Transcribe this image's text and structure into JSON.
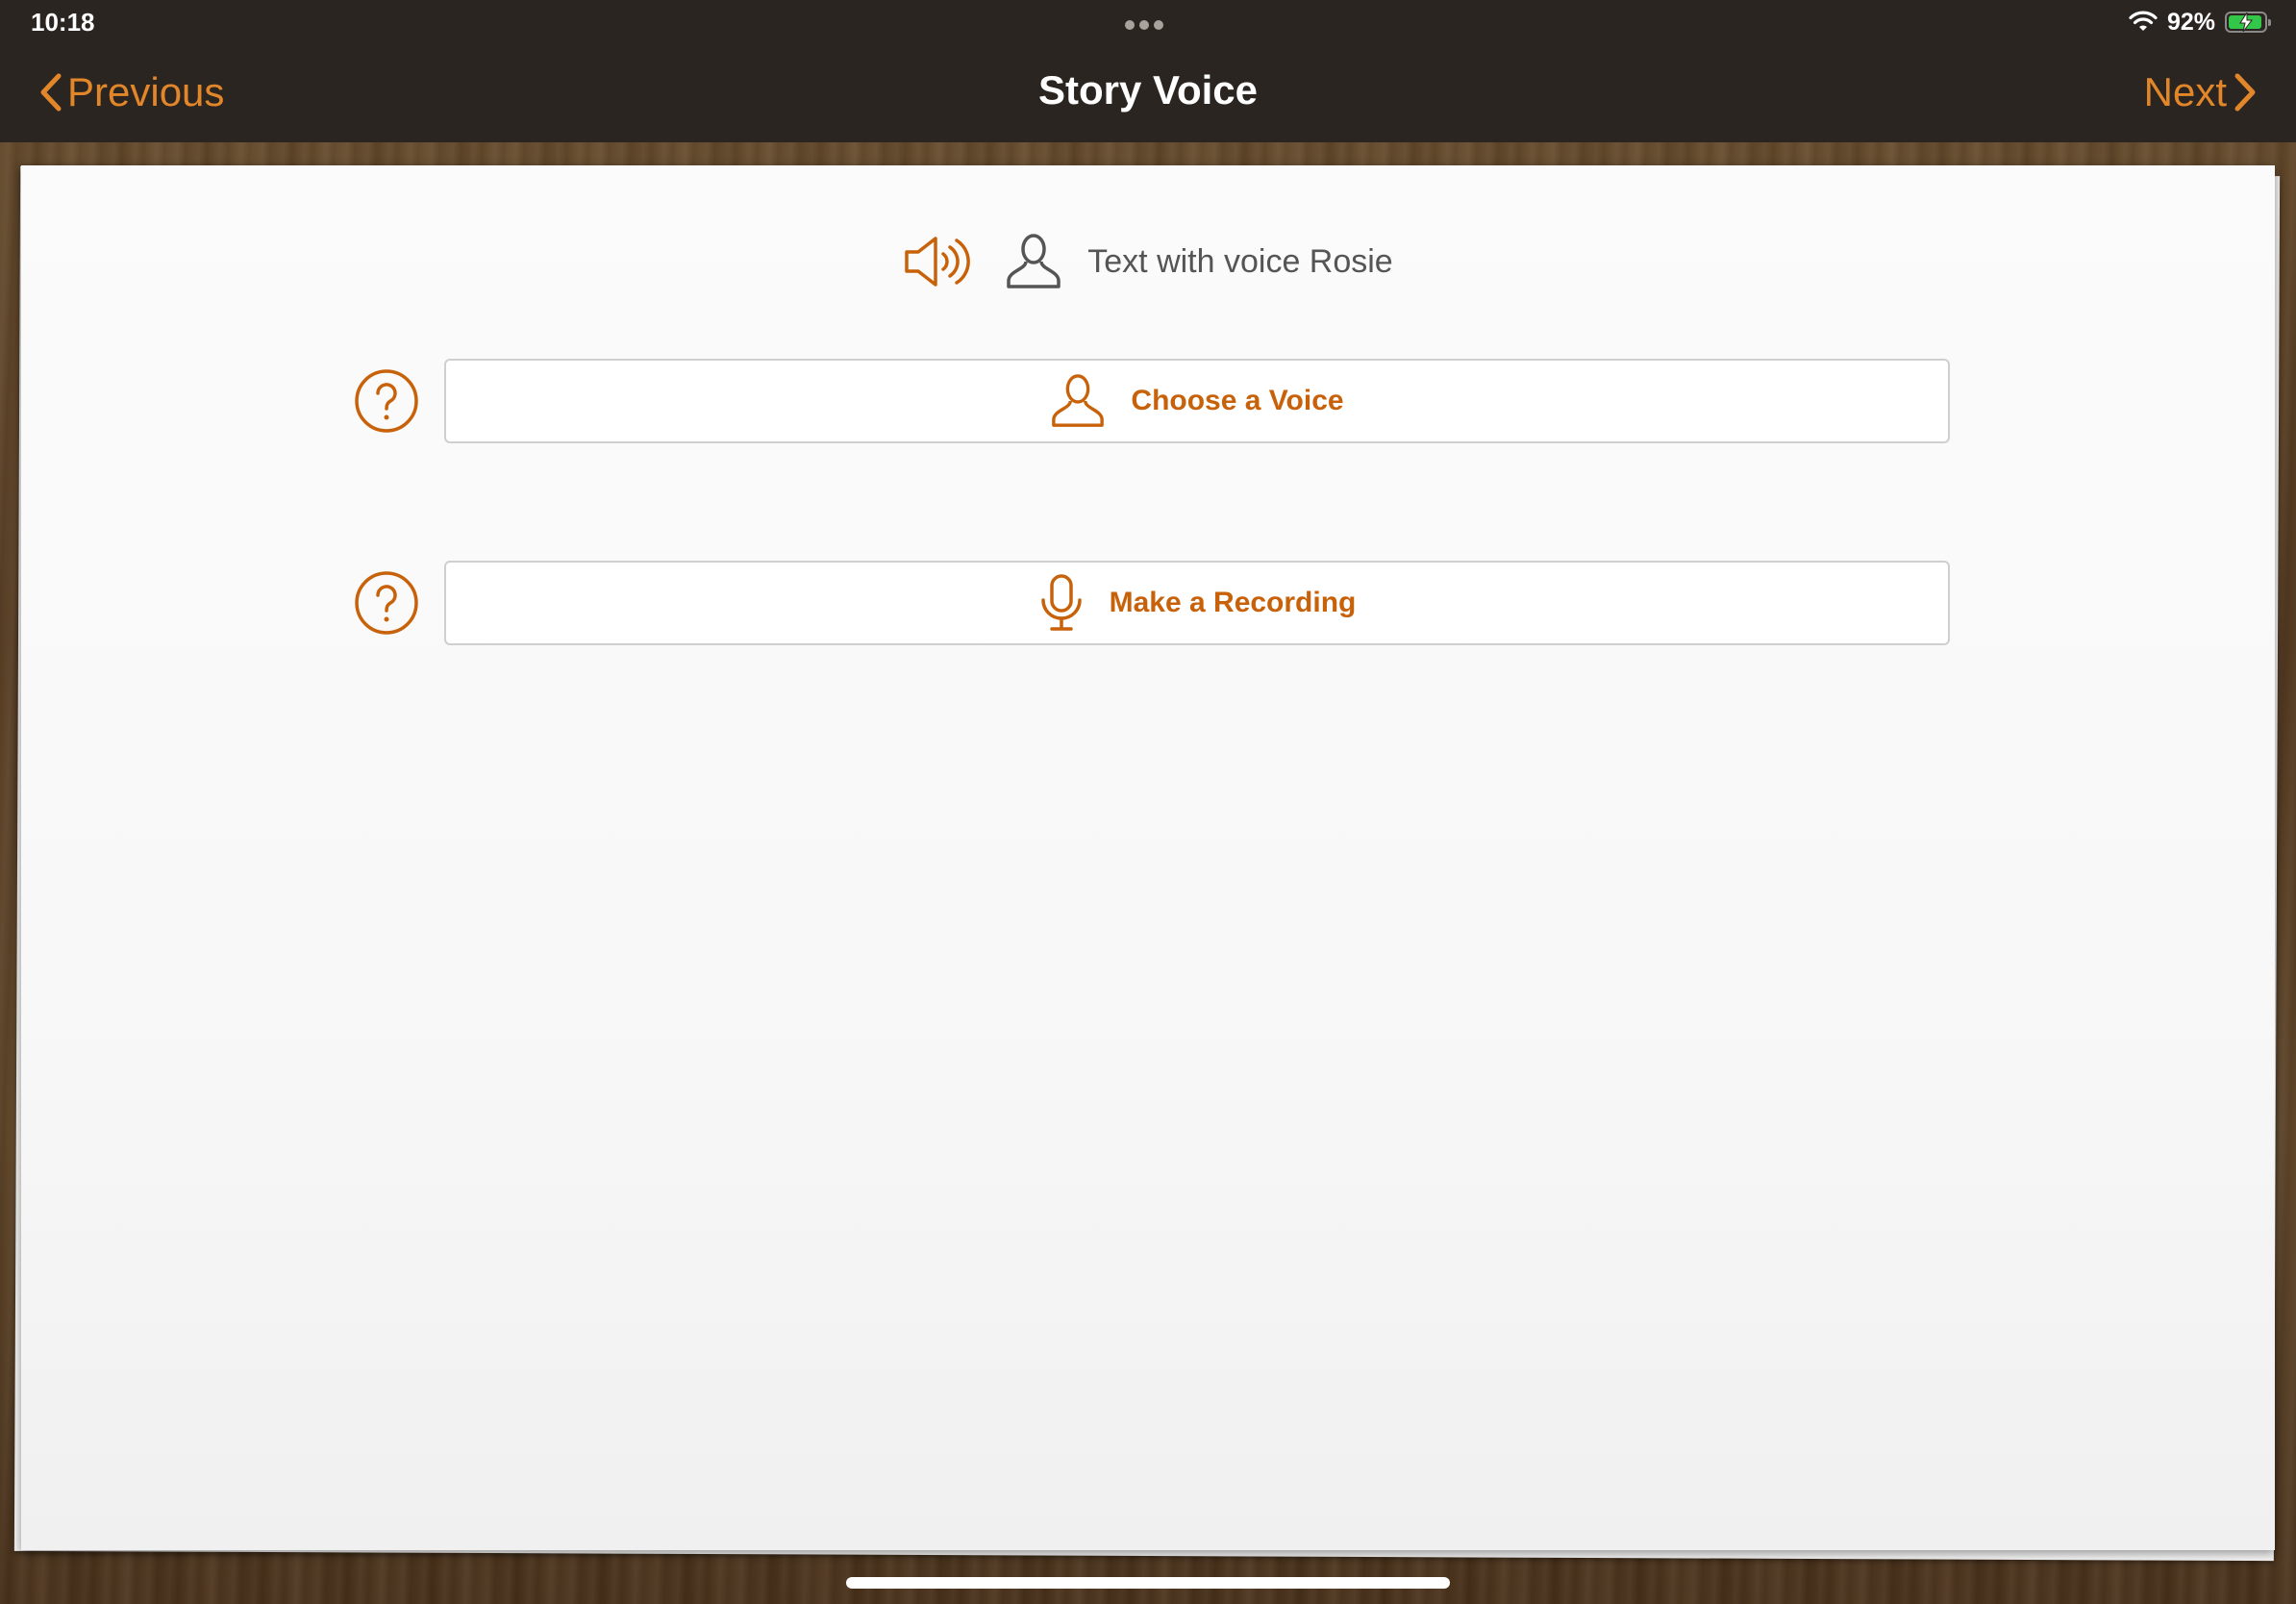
{
  "status_bar": {
    "time": "10:18",
    "battery_percent": "92%"
  },
  "nav": {
    "previous_label": "Previous",
    "title": "Story Voice",
    "next_label": "Next"
  },
  "voice_status": {
    "text": "Text with voice Rosie"
  },
  "actions": [
    {
      "label": "Choose a Voice",
      "icon": "person-icon"
    },
    {
      "label": "Make a Recording",
      "icon": "microphone-icon"
    }
  ],
  "colors": {
    "accent": "#e2862a",
    "button_text": "#c8620a",
    "bar_background": "#2a2520"
  }
}
